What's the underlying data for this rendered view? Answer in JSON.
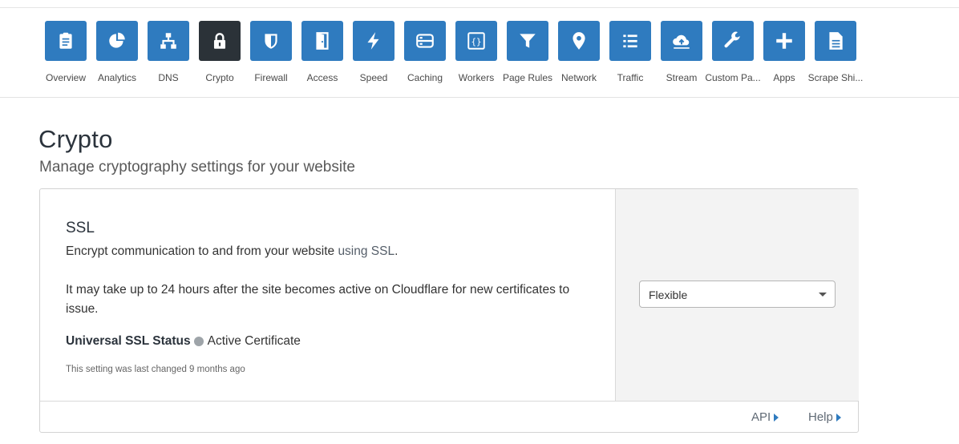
{
  "nav": {
    "items": [
      {
        "label": "Overview",
        "icon": "clipboard-icon"
      },
      {
        "label": "Analytics",
        "icon": "pie-chart-icon"
      },
      {
        "label": "DNS",
        "icon": "network-tree-icon"
      },
      {
        "label": "Crypto",
        "icon": "lock-icon",
        "active": true
      },
      {
        "label": "Firewall",
        "icon": "shield-icon"
      },
      {
        "label": "Access",
        "icon": "door-icon"
      },
      {
        "label": "Speed",
        "icon": "lightning-icon"
      },
      {
        "label": "Caching",
        "icon": "server-icon"
      },
      {
        "label": "Workers",
        "icon": "code-braces-icon"
      },
      {
        "label": "Page Rules",
        "icon": "filter-icon"
      },
      {
        "label": "Network",
        "icon": "location-pin-icon"
      },
      {
        "label": "Traffic",
        "icon": "list-icon"
      },
      {
        "label": "Stream",
        "icon": "cloud-upload-icon"
      },
      {
        "label": "Custom Pa...",
        "icon": "wrench-icon"
      },
      {
        "label": "Apps",
        "icon": "plus-icon"
      },
      {
        "label": "Scrape Shi...",
        "icon": "document-icon"
      }
    ]
  },
  "page": {
    "title": "Crypto",
    "subtitle": "Manage cryptography settings for your website"
  },
  "ssl": {
    "title": "SSL",
    "desc_prefix": "Encrypt communication to and from your website ",
    "desc_link": "using SSL",
    "desc_suffix": ".",
    "note": "It may take up to 24 hours after the site becomes active on Cloudflare for new certificates to issue.",
    "status_label": "Universal SSL Status",
    "status_value": "Active Certificate",
    "changed": "This setting was last changed 9 months ago",
    "mode": "Flexible"
  },
  "footer": {
    "api": "API",
    "help": "Help"
  },
  "colors": {
    "accent": "#2f7bbf",
    "active_tile": "#2b3238",
    "status_dot": "#9ea4a9"
  }
}
